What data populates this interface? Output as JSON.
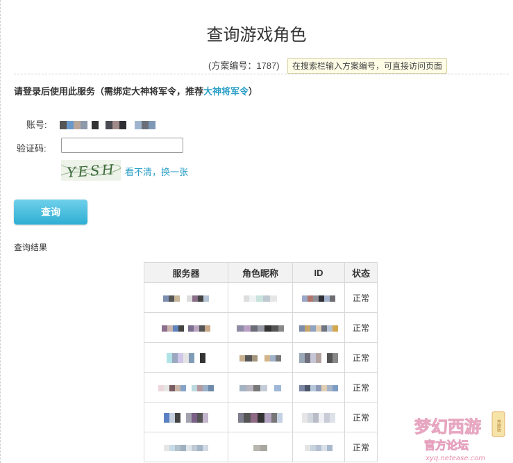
{
  "page": {
    "title": "查询游戏角色",
    "scheme_label": "(方案编号：1787)",
    "scheme_tip": "在搜索栏输入方案编号，可直接访问页面"
  },
  "notice": {
    "prefix": "请登录后使用此服务（需绑定大神将军令，推荐",
    "link": "大神将军令",
    "suffix": "）"
  },
  "form": {
    "account_label": "账号:",
    "captcha_label": "验证码:",
    "captcha_value": "",
    "captcha_text": "YESH",
    "refresh_link": "看不清，换一张",
    "query_button": "查询"
  },
  "results": {
    "title": "查询结果",
    "columns": [
      "服务器",
      "角色昵称",
      "ID",
      "状态"
    ],
    "rows": [
      {
        "status": "正常"
      },
      {
        "status": "正常"
      },
      {
        "status": "正常"
      },
      {
        "status": "正常"
      },
      {
        "status": "正常"
      },
      {
        "status": "正常"
      }
    ]
  },
  "logo": {
    "main_text": "梦幻西游",
    "sub_text": "官方论坛",
    "url_text": "xyq.netease.com",
    "badge": "电脑版"
  },
  "colors": {
    "link": "#2b9fc7",
    "button_top": "#6fd0ea",
    "button_bottom": "#2eaed4",
    "tip_bg": "#fffde6",
    "header_bg": "#f2f2f2"
  }
}
